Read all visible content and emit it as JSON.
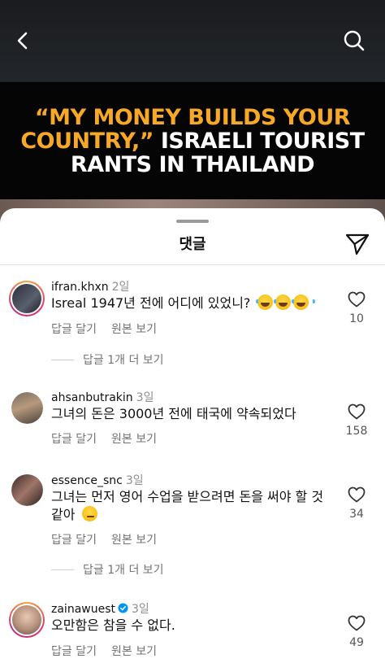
{
  "video": {
    "headline": {
      "line1_quote": "“MY MONEY BUILDS YOUR",
      "line2_quote": "COUNTRY,”",
      "line2_rest": " ISRAELI TOURIST",
      "line3": "RANTS IN THAILAND"
    }
  },
  "colors": {
    "headline_accent": "#f6a826",
    "verified": "#0095f6",
    "muted": "#737373"
  },
  "sheet": {
    "title": "댓글"
  },
  "icons": {
    "back": "chevron-left-icon",
    "search": "search-icon",
    "share": "paper-plane-icon",
    "like": "heart-outline-icon"
  },
  "comments": [
    {
      "username": "ifran.khxn",
      "age": "2일",
      "text": "Isreal 1947년 전에 어디에 있었니?",
      "emoji": [
        "face-with-tears-of-joy",
        "face-with-tears-of-joy",
        "face-with-tears-of-joy"
      ],
      "reply": "답글 달기",
      "original": "원본 보기",
      "likes": "10",
      "more_replies": "답글 1개 더 보기"
    },
    {
      "username": "ahsanbutrakin",
      "age": "3일",
      "text": "그녀의 돈은 3000년 전에 태국에 약속되었다",
      "reply": "답글 달기",
      "original": "원본 보기",
      "likes": "158"
    },
    {
      "username": "essence_snc",
      "age": "3일",
      "text_line1": "그녀는 먼저 영어 수업을 받으려면 돈을 써야 할 것",
      "text_line2": "같아",
      "emoji": [
        "smirking-face"
      ],
      "reply": "답글 달기",
      "original": "원본 보기",
      "likes": "34",
      "more_replies": "답글 1개 더 보기"
    },
    {
      "username": "zainawuest",
      "verified": true,
      "age": "3일",
      "text": "오만함은 참을 수 없다.",
      "reply": "답글 달기",
      "original": "원본 보기",
      "likes": "49"
    }
  ]
}
